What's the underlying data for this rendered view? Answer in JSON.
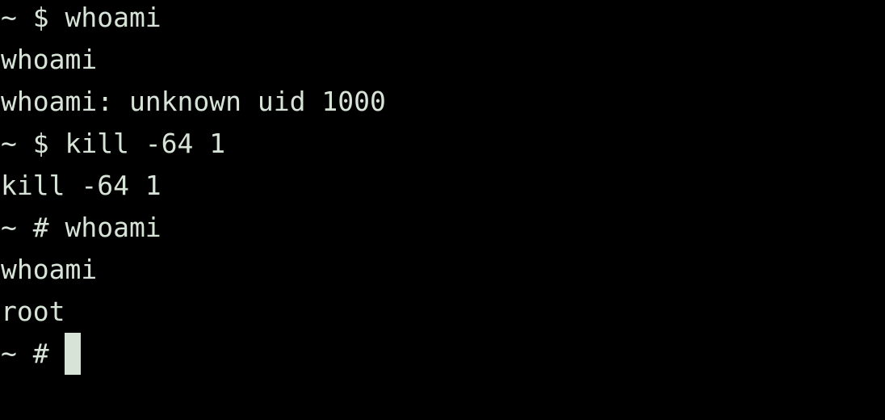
{
  "terminal": {
    "lines": [
      "~ $ whoami",
      "whoami",
      "whoami: unknown uid 1000",
      "~ $ kill -64 1",
      "kill -64 1",
      "~ # whoami",
      "whoami",
      "root"
    ],
    "prompt": "~ # ",
    "colors": {
      "background": "#000000",
      "foreground": "#d8e3d8",
      "cursor": "#d8e3d8"
    }
  }
}
